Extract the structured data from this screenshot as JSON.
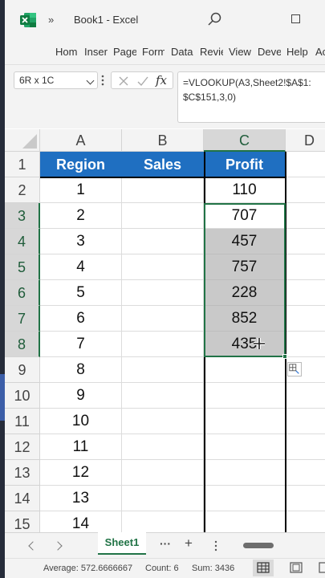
{
  "window": {
    "app_icon": "excel-logo-icon",
    "qat_more": "»",
    "title": "Book1  -  Excel"
  },
  "ribbon": {
    "tabs": [
      "Hom",
      "Inser",
      "Page",
      "Form",
      "Data",
      "Revie",
      "View",
      "Deve",
      "Help",
      "Ac"
    ]
  },
  "formula_bar": {
    "name_box": "6R x 1C",
    "fx_label": "fx",
    "formula_line1": "=VLOOKUP(A3,Sheet2!$A$1:",
    "formula_line2": "$C$151,3,0)"
  },
  "grid": {
    "columns": [
      "A",
      "B",
      "C",
      "D"
    ],
    "rows": [
      "1",
      "2",
      "3",
      "4",
      "5",
      "6",
      "7",
      "8",
      "9",
      "10",
      "11",
      "12",
      "13",
      "14",
      "15"
    ],
    "header_row": [
      "Region",
      "Sales",
      "Profit"
    ],
    "data": [
      [
        "1",
        "",
        "110"
      ],
      [
        "2",
        "",
        "707"
      ],
      [
        "3",
        "",
        "457"
      ],
      [
        "4",
        "",
        "757"
      ],
      [
        "5",
        "",
        "228"
      ],
      [
        "6",
        "",
        "852"
      ],
      [
        "7",
        "",
        "435"
      ],
      [
        "8",
        "",
        ""
      ],
      [
        "9",
        "",
        ""
      ],
      [
        "10",
        "",
        ""
      ],
      [
        "11",
        "",
        ""
      ],
      [
        "12",
        "",
        ""
      ],
      [
        "13",
        "",
        ""
      ],
      [
        "14",
        "",
        ""
      ]
    ]
  },
  "sheet_tabs": {
    "active": "Sheet1",
    "more": "···",
    "add": "+"
  },
  "status": {
    "average": "Average: 572.6666667",
    "count": "Count: 6",
    "sum": "Sum: 3436"
  },
  "colors": {
    "header_fill": "#1f6fc1",
    "selection": "#217346",
    "highlight": "#c9c9c9"
  }
}
